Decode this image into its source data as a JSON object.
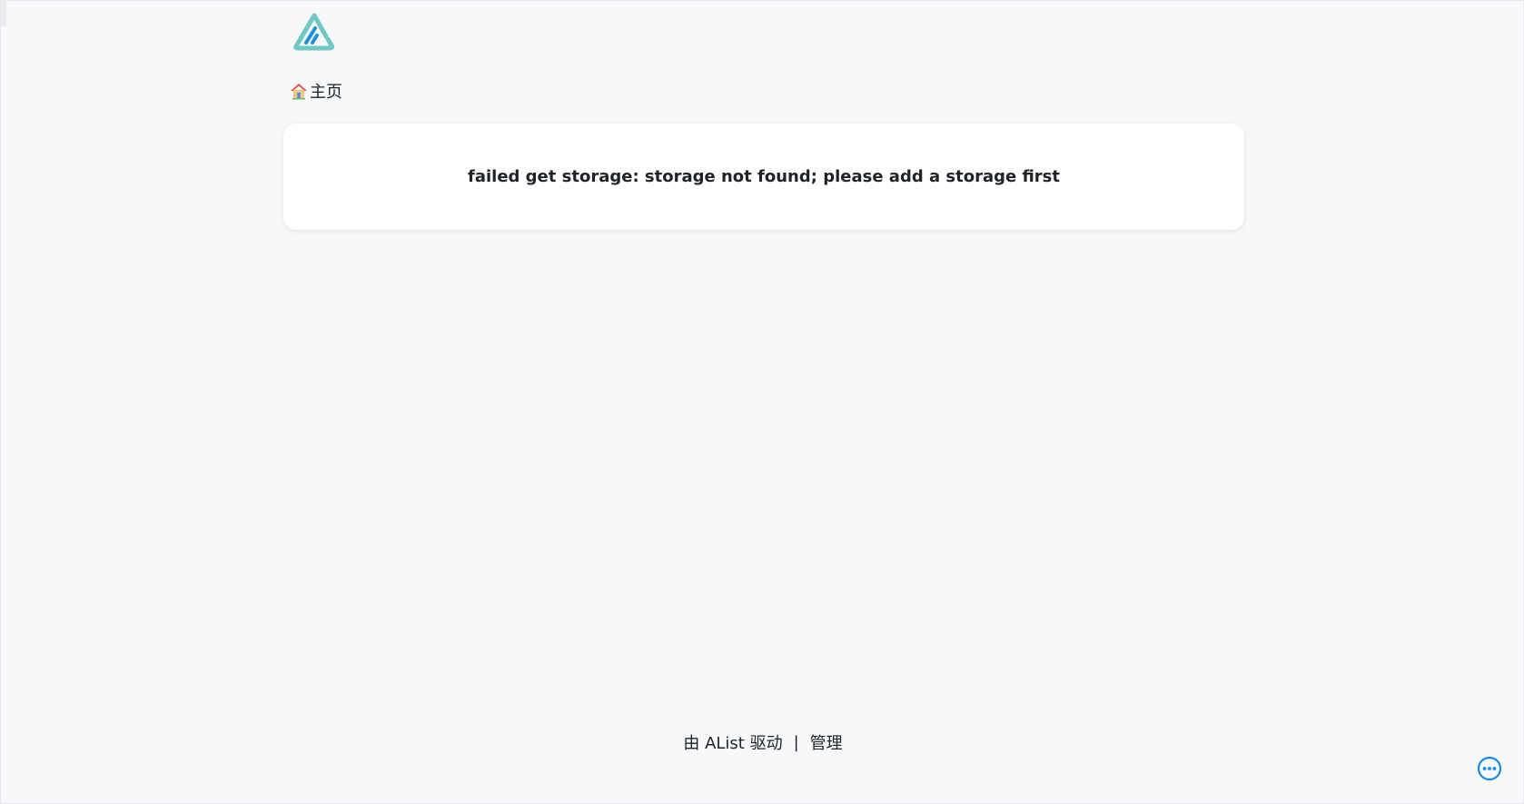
{
  "breadcrumb": {
    "home_label": "主页"
  },
  "message": {
    "error": "failed get storage: storage not found; please add a storage first"
  },
  "footer": {
    "powered_by": "由 AList 驱动",
    "separator": "|",
    "admin_label": "管理"
  },
  "icons": {
    "logo": "alist-logo-icon",
    "home": "house-icon",
    "more": "more-dots-icon"
  },
  "colors": {
    "background": "#f7f8fa",
    "card": "#ffffff",
    "logo_teal": "#6fc8c4",
    "logo_blue": "#1e90d6",
    "accent_blue": "#1e88e5"
  }
}
